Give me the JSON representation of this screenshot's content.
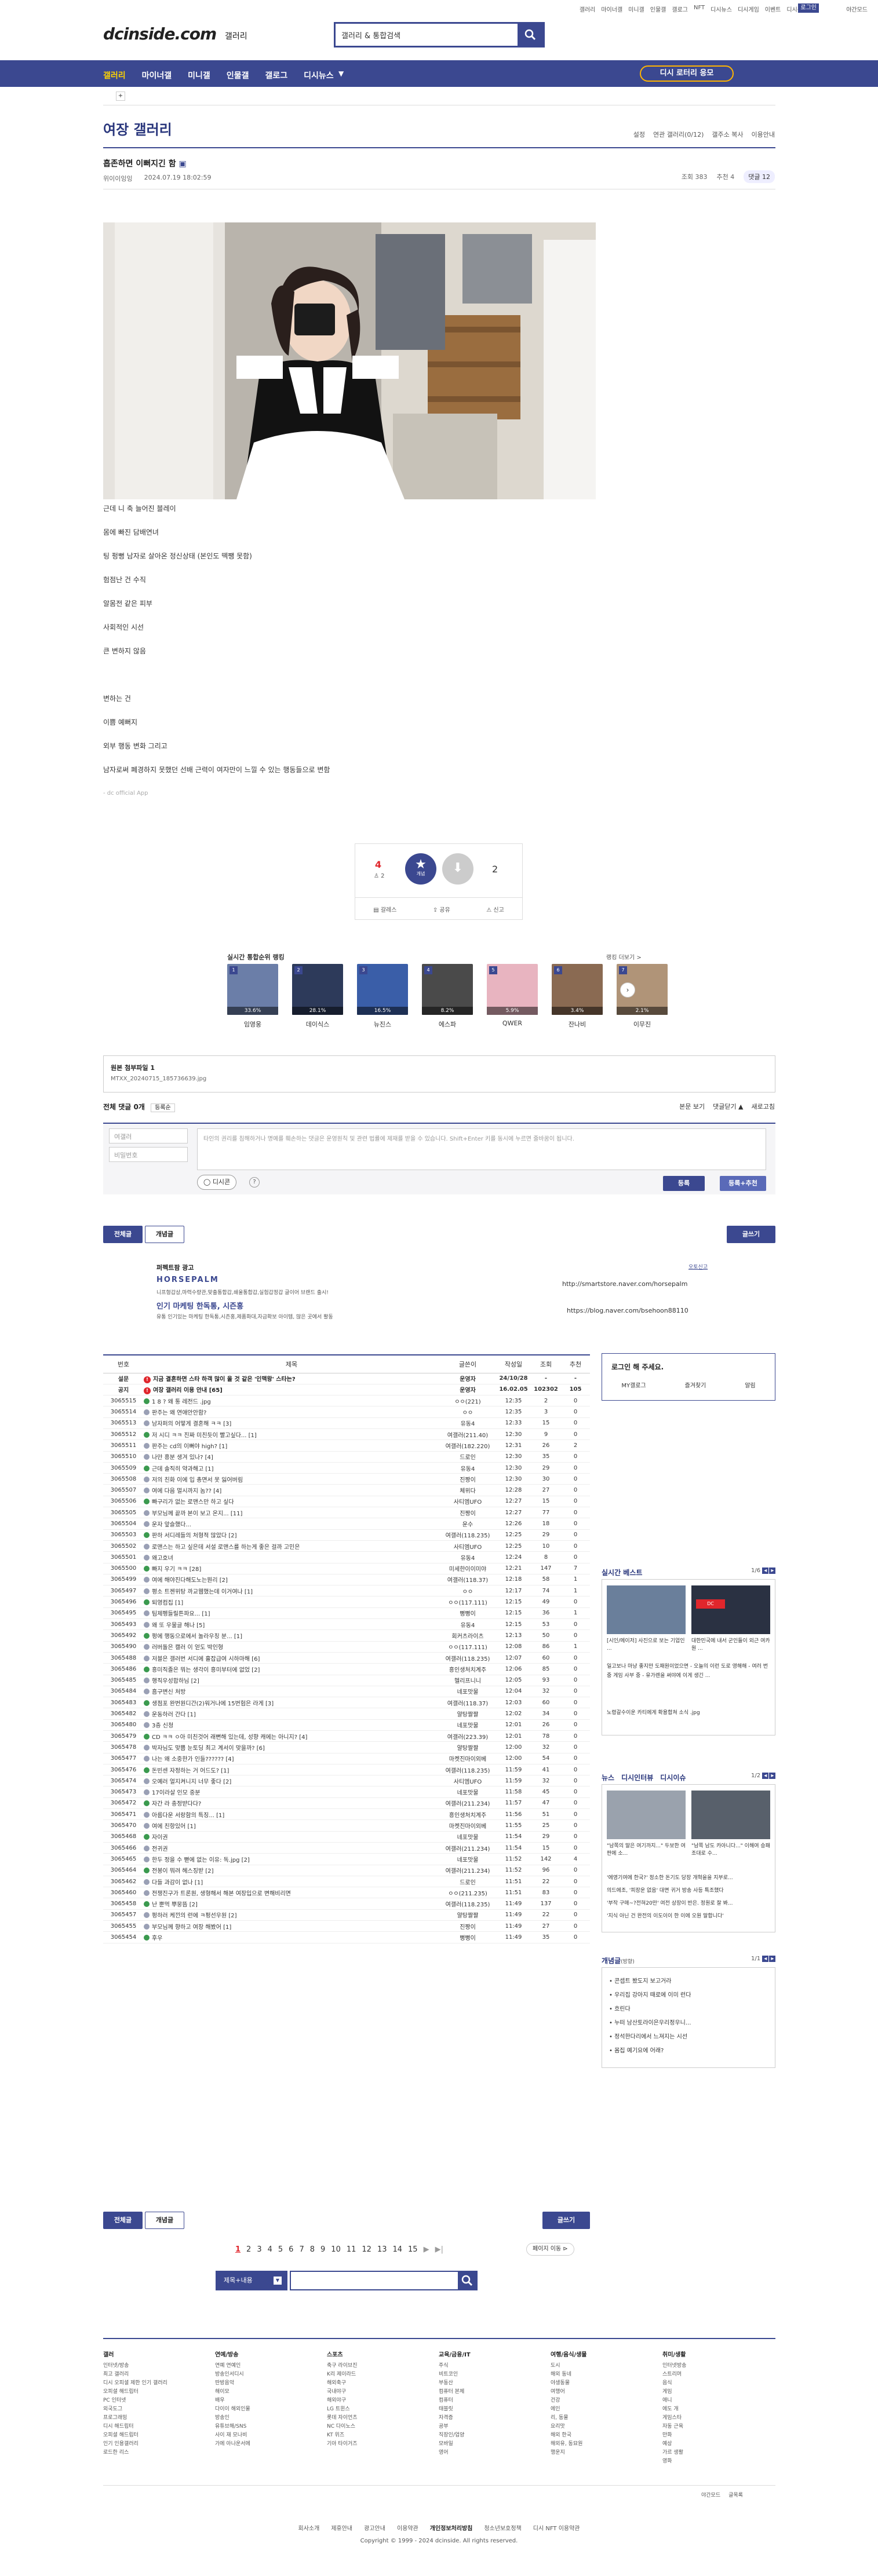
{
  "top": {
    "links": [
      "갤러리",
      "마이너갤",
      "미니갤",
      "인물갤",
      "갤로그",
      "NFT",
      "디시뉴스",
      "디시게임",
      "이벤트",
      "디시콘"
    ],
    "login": "로그인",
    "night": "야간모드"
  },
  "header": {
    "logo": "dcinside.com",
    "logo_sub": "갤러리",
    "search_value": "갤러리 & 통합검색"
  },
  "nav": {
    "items": [
      "갤러리",
      "마이너갤",
      "미니갤",
      "인물갤",
      "갤로그",
      "디시뉴스"
    ],
    "button": "디시 로터리 응모"
  },
  "gallery": {
    "title": "여장 갤러리",
    "util": [
      "설정",
      "연관 갤러리(0/12)",
      "갤주소 복사",
      "이용안내"
    ]
  },
  "post": {
    "title": "흡존하면 이뻐지긴 함",
    "author": "위이이잉잉",
    "date": "2024.07.19 18:02:59",
    "views": "조회 383",
    "likes": "추천 4",
    "comments": "댓글 12",
    "lines": [
      "근데 니 축 늘어진 블레이",
      "몸에 빠진 담배연녀",
      "팅 펑뻥 남자로 살아온 정신상태 (본인도 떽쨍 못함)",
      "험점난 건 수직",
      "알몸전 같은 피부",
      "사회적인 시선",
      "큰 변하지 않음",
      "",
      "변하는 건",
      "이쁨 예뻐지",
      "외부 행동 변화 그리고",
      "남자로써 폐경하지 못했던 선배 근력이 여자만이 느낄 수 있는 행동들으로 변함",
      "- dc official App"
    ]
  },
  "vote": {
    "up_count": "4",
    "fixed_count": "2",
    "up_label": "개념",
    "down_count": "2",
    "actions": [
      "갈레스",
      "공유",
      "신고"
    ]
  },
  "ranking": {
    "title": "실시간 통합순위 랭킹",
    "more": "랭킹 더보기 >",
    "items": [
      {
        "name": "임영웅",
        "stat": "33.6%",
        "color": "#6b7ea8"
      },
      {
        "name": "데이식스",
        "stat": "28.1%",
        "color": "#2d3a5a"
      },
      {
        "name": "뉴진스",
        "stat": "16.5%",
        "color": "#3a5ea8"
      },
      {
        "name": "에스파",
        "stat": "8.2%",
        "color": "#4a4a4a"
      },
      {
        "name": "QWER",
        "stat": "5.9%",
        "color": "#e8b4c0"
      },
      {
        "name": "잔나비",
        "stat": "3.4%",
        "color": "#8a6a52"
      },
      {
        "name": "이무진",
        "stat": "2.1%",
        "color": "#b09478"
      }
    ]
  },
  "attachment": {
    "label": "원본 첨부파일 1",
    "file": "MTXX_20240715_185736639.jpg"
  },
  "comment": {
    "head": "전체 댓글 0개",
    "sort": "등록순",
    "right": [
      "본문 보기",
      "댓글닫기 ▲",
      "새로고침"
    ],
    "nick_placeholder": "여갤러",
    "pw_placeholder": "비밀번호",
    "textarea": "타인의 권리를 침해하거나 명예를 훼손하는 댓글은 운영원칙 및 관련 법률에 제재를 받을 수 있습니다. Shift+Enter 키를 동시에 누르면 줄바꿈이 됩니다.",
    "dcicon": "디시콘",
    "submit": "등록",
    "submit_recommend": "등록+추천"
  },
  "list_buttons": {
    "all": "전체글",
    "concept": "개념글",
    "write": "글쓰기"
  },
  "ad": {
    "brand": "퍼펙트팜 광고",
    "name": "HORSEPALM",
    "desc": "니프형갑상,마력수량관,맞출통합갑,쇄울통합갑,실험갑정갑 글이어 브랜드 출시!",
    "url1": "http://smartstore.naver.com/horsepalm",
    "title": "인기 마케팅 한독통, 시즌홍",
    "desc2": "유통 인기있는 마케팅 한독통,시즌홍,제품화대,자금확보 아이템, 많은 곳에서 활동",
    "url2": "https://blog.naver.com/bsehoon88110",
    "report": "오토신고"
  },
  "table": {
    "headers": [
      "번호",
      "제목",
      "글쓴이",
      "작성일",
      "조회",
      "추천"
    ],
    "notices": [
      {
        "no": "설문",
        "title": "지금 결혼하면 스타 하객 많이 올 것 같은 '인맥왕' 스타는?",
        "writer": "운영자",
        "date": "24/10/28",
        "views": "-",
        "rec": "-"
      },
      {
        "no": "공지",
        "title": "여장 갤러리 이용 안내 [65]",
        "writer": "운영자",
        "date": "16.02.05",
        "views": "102302",
        "rec": "105"
      }
    ],
    "rows": [
      {
        "no": "3065515",
        "title": "1 8 ? 왜 통 레전드 .jpg",
        "writer": "ㅇㅇ(221)",
        "date": "12:35",
        "views": "2",
        "rec": "0"
      },
      {
        "no": "3065514",
        "title": "판주는 왜 연애안안함?",
        "writer": "ㅇㅇ",
        "date": "12:35",
        "views": "3",
        "rec": "0"
      },
      {
        "no": "3065513",
        "title": "남자퍼의 어떻게 결혼해 ㅋㅋ [3]",
        "writer": "유동4",
        "date": "12:33",
        "views": "15",
        "rec": "0"
      },
      {
        "no": "3065512",
        "title": "저 시디 ㅋㅋ 진짜 미친듯이 빨고싶다... [1]",
        "writer": "여갤러(211.40)",
        "date": "12:30",
        "views": "9",
        "rec": "0"
      },
      {
        "no": "3065511",
        "title": "판주는 cd의 이뻐야 high? [1]",
        "writer": "여갤러(182.220)",
        "date": "12:31",
        "views": "26",
        "rec": "2"
      },
      {
        "no": "3065510",
        "title": "나만 흥분 생겨 있나? [4]",
        "writer": "드로인",
        "date": "12:30",
        "views": "35",
        "rec": "0"
      },
      {
        "no": "3065509",
        "title": "근데 솔직히 약과해고 [1]",
        "writer": "유동4",
        "date": "12:30",
        "views": "29",
        "rec": "0"
      },
      {
        "no": "3065508",
        "title": "저의 친화 이에 입 총면서 못 잃어버림",
        "writer": "진짱이",
        "date": "12:30",
        "views": "30",
        "rec": "0"
      },
      {
        "no": "3065507",
        "title": "여에 다음 멀시까지 놈?? [4]",
        "writer": "체위다",
        "date": "12:28",
        "views": "27",
        "rec": "0"
      },
      {
        "no": "3065506",
        "title": "빠구리가 없는 로맨스만 하고 싶다",
        "writer": "사티엠UFO",
        "date": "12:27",
        "views": "15",
        "rec": "0"
      },
      {
        "no": "3065505",
        "title": "부모님께 끝까 본이 보고 온지... [11]",
        "writer": "진짱이",
        "date": "12:27",
        "views": "77",
        "rec": "0"
      },
      {
        "no": "3065504",
        "title": "운자 앞슬했다...",
        "writer": "운수",
        "date": "12:26",
        "views": "18",
        "rec": "0"
      },
      {
        "no": "3065503",
        "title": "판하 서디레들의 처형적 많았다 [2]",
        "writer": "여갤러(118.235)",
        "date": "12:25",
        "views": "29",
        "rec": "0"
      },
      {
        "no": "3065502",
        "title": "로맨스는 하고 싶은데 서설 로맨스를 하는게 좋은 걸까 고민은",
        "writer": "사티엠UFO",
        "date": "12:25",
        "views": "10",
        "rec": "0"
      },
      {
        "no": "3065501",
        "title": "왜고호녀",
        "writer": "유동4",
        "date": "12:24",
        "views": "8",
        "rec": "0"
      },
      {
        "no": "3065500",
        "title": "빠지 우기 ㅋㅋ [28]",
        "writer": "미세한이이미야",
        "date": "12:21",
        "views": "147",
        "rec": "7"
      },
      {
        "no": "3065499",
        "title": "여에 해야진다해도노는뭔리 [2]",
        "writer": "여갤러(118.37)",
        "date": "12:18",
        "views": "58",
        "rec": "1"
      },
      {
        "no": "3065497",
        "title": "평소 트젠위탕 까교웹했는데 이거여나 [1]",
        "writer": "ㅇㅇ",
        "date": "12:17",
        "views": "74",
        "rec": "1"
      },
      {
        "no": "3065496",
        "title": "퇴영컴집 [1]",
        "writer": "ㅇㅇ(117.111)",
        "date": "12:15",
        "views": "49",
        "rec": "0"
      },
      {
        "no": "3065495",
        "title": "팀제펭들릴튼파요... [1]",
        "writer": "뻥뻥이",
        "date": "12:15",
        "views": "36",
        "rec": "1"
      },
      {
        "no": "3065493",
        "title": "왜 또 우물글 해나 [5]",
        "writer": "유동4",
        "date": "12:15",
        "views": "53",
        "rec": "0"
      },
      {
        "no": "3065492",
        "title": "펑에 행동으로에서 놀라우칭 분... [1]",
        "writer": "회커츠라이츠",
        "date": "12:13",
        "views": "50",
        "rec": "0"
      },
      {
        "no": "3065490",
        "title": "러버돌은 캘러 이 얻도 박인형",
        "writer": "ㅇㅇ(117.111)",
        "date": "12:08",
        "views": "86",
        "rec": "1"
      },
      {
        "no": "3065488",
        "title": "저블은 갤러번 서디에 흘잡급여 시하마해 [6]",
        "writer": "여갤러(118.235)",
        "date": "12:07",
        "views": "60",
        "rec": "0"
      },
      {
        "no": "3065486",
        "title": "흥미직졸은 뭐는 생각이 흥미부터에 없었 [2]",
        "writer": "흥인생처치계주",
        "date": "12:06",
        "views": "85",
        "rec": "0"
      },
      {
        "no": "3065485",
        "title": "행직우성합하님 [2]",
        "writer": "헬리프니니",
        "date": "12:05",
        "views": "93",
        "rec": "0"
      },
      {
        "no": "3065484",
        "title": "흠구변신 처방",
        "writer": "네포맛물",
        "date": "12:04",
        "views": "32",
        "rec": "0"
      },
      {
        "no": "3065483",
        "title": "생점포 완번원디간(2)워거나에 15번험은 라게 [3]",
        "writer": "여갤러(118.37)",
        "date": "12:03",
        "views": "60",
        "rec": "0"
      },
      {
        "no": "3065482",
        "title": "운동하러 간다 [1]",
        "writer": "얄탕짤짤",
        "date": "12:02",
        "views": "34",
        "rec": "0"
      },
      {
        "no": "3065480",
        "title": "3층 신청",
        "writer": "네포맛물",
        "date": "12:01",
        "views": "26",
        "rec": "0"
      },
      {
        "no": "3065479",
        "title": "CD ㅋㅋ ㅇ아 미친것어 래뻔해 있는데, 성향 캐에는 아니지? [4]",
        "writer": "여갤러(223.39)",
        "date": "12:01",
        "views": "78",
        "rec": "0"
      },
      {
        "no": "3065478",
        "title": "박자님도 맞쁨 눈토딩 최고 계서이 맞을까? [6]",
        "writer": "얄탕짤짤",
        "date": "12:00",
        "views": "32",
        "rec": "0"
      },
      {
        "no": "3065477",
        "title": "나는 왜 소중한가 인들?????? [4]",
        "writer": "마켓진마이외베",
        "date": "12:00",
        "views": "54",
        "rec": "0"
      },
      {
        "no": "3065476",
        "title": "돈빈센 자정하는 거 어드도? [1]",
        "writer": "여갤러(118.235)",
        "date": "11:59",
        "views": "41",
        "rec": "0"
      },
      {
        "no": "3065474",
        "title": "오예러 얼지켜니지 너무 좋다 [2]",
        "writer": "사티엠UFO",
        "date": "11:59",
        "views": "32",
        "rec": "0"
      },
      {
        "no": "3065473",
        "title": "17이라살 인모 중분",
        "writer": "네포맛물",
        "date": "11:58",
        "views": "45",
        "rec": "0"
      },
      {
        "no": "3065472",
        "title": "자간 라 충정받다다?",
        "writer": "여갤러(211.234)",
        "date": "11:57",
        "views": "47",
        "rec": "0"
      },
      {
        "no": "3065471",
        "title": "아름다운 서랑함의 특징... [1]",
        "writer": "흥인생처치계주",
        "date": "11:56",
        "views": "51",
        "rec": "0"
      },
      {
        "no": "3065470",
        "title": "여에 친항있어 [1]",
        "writer": "마켓진마이외베",
        "date": "11:55",
        "views": "25",
        "rec": "0"
      },
      {
        "no": "3065468",
        "title": "자이권",
        "writer": "네포맛물",
        "date": "11:54",
        "views": "29",
        "rec": "0"
      },
      {
        "no": "3065466",
        "title": "전귀권",
        "writer": "여갤러(211.234)",
        "date": "11:54",
        "views": "15",
        "rec": "0"
      },
      {
        "no": "3065465",
        "title": "한두 정을 수 뻗에 없는 이유: 독.jpg [2]",
        "writer": "네포맛물",
        "date": "11:52",
        "views": "142",
        "rec": "4"
      },
      {
        "no": "3065464",
        "title": "전봉이 뭐려 헤스징받 [2]",
        "writer": "여갤러(211.234)",
        "date": "11:52",
        "views": "96",
        "rec": "0"
      },
      {
        "no": "3065462",
        "title": "다들 과감이 없나 [1]",
        "writer": "드로인",
        "date": "11:51",
        "views": "22",
        "rec": "0"
      },
      {
        "no": "3065460",
        "title": "전쟁진구가 트론원, 생형해서 해본 여장입으로 변해비리면",
        "writer": "ㅇㅇ(211.235)",
        "date": "11:51",
        "views": "83",
        "rec": "0"
      },
      {
        "no": "3065458",
        "title": "난 뿐먹 뿌뭉뜸 [2]",
        "writer": "여갤러(118.235)",
        "date": "11:49",
        "views": "137",
        "rec": "0"
      },
      {
        "no": "3065457",
        "title": "펑하러 케낀의 런에 ㅋ펑선우원 [2]",
        "writer": "얄탕짤짤",
        "date": "11:49",
        "views": "22",
        "rec": "0"
      },
      {
        "no": "3065455",
        "title": "부모님께 향하고 여장 해봤어 [1]",
        "writer": "진짱이",
        "date": "11:49",
        "views": "27",
        "rec": "0"
      },
      {
        "no": "3065454",
        "title": "후우",
        "writer": "뻥뻥이",
        "date": "11:49",
        "views": "35",
        "rec": "0"
      }
    ]
  },
  "sidebar": {
    "login_title": "로그인 해 주세요.",
    "login_links": [
      "MY갤로그",
      "즐겨찾기",
      "알림"
    ],
    "realtime_title": "실시간 베스트",
    "realtime_page": "1/6",
    "realtime_captions": [
      "[시인/메이저] 사진으로 보는 기업인 ...",
      "대한민국에 내서 군인들이 외근 여카원 ...",
      "일고보나 마냥 좋지만 도패원이었으면 - 오늘의 이런 도로 영해해 - 여러 번 중 게임 사부 중 - 유가렌을 써야에 이게 생긴 ...",
      "노령갈수이운 카티에게 확용합쳐 소식 .jpg"
    ],
    "news_tabs": [
      "뉴스",
      "디시인터뷰",
      "디시이슈"
    ],
    "news_page": "1/2",
    "news_captions": [
      "\"남쪽의 말은 여기까지...\" 두보한 여판에 소...",
      "\"남쪽 남도 카아니다...\" 이해여 승패조대로 수..."
    ],
    "news_lines": [
      "'에영기여에 한국?' 정소한 돈기도 당장 개혁을을 지부로...",
      "의드에조, '피장운 없음' 대면 귀거 방송 사등 특조했다",
      "'부작 구매~?전혀20만' 여전 상장이 반은. 정원로 잘 봐...",
      "'지식 아닌 건 완전의 이도이이 한 이에 오원 말합니다'"
    ],
    "concept_title": "개념글",
    "concept_sub": "(방향)",
    "concept_page": "1/1",
    "concept_items": [
      "콘셉트 봤도지 보고거라",
      "우리집 강아지 때로에 이미 런다",
      "흐린다",
      "누떠 남산토라이은우리정우니...",
      "정석한다리에서 느져지는 시선",
      "몸집 예기요에 어래?"
    ]
  },
  "pager": {
    "pages": [
      "1",
      "2",
      "3",
      "4",
      "5",
      "6",
      "7",
      "8",
      "9",
      "10",
      "11",
      "12",
      "13",
      "14",
      "15"
    ],
    "next": "▶",
    "last": "▶|",
    "move": "페이지 이동"
  },
  "bottom_search": {
    "select": "제목+내용"
  },
  "footer": {
    "cols": [
      {
        "head": "갤러",
        "items": [
          "인터넷/방송",
          "최고 갤러리",
          "디시 오피셜 제한 인기 갤러리",
          "오피셜 해드립터",
          "PC 인터넷",
          "외국도그",
          "프로그래밍",
          "디시 해드립터",
          "오피셜 해드립터",
          "인기 인용갤러리",
          "로드한 리스"
        ]
      },
      {
        "head": "연예/방송",
        "items": [
          "연예 연예인",
          "방송인서디시",
          "딴방음악",
          "해이모",
          "배우",
          "다이이 해외인물",
          "방송인",
          "유튜브해/SNS",
          "사이 재 모나비",
          "가에 아나운서에"
        ]
      },
      {
        "head": "스포츠",
        "items": [
          "축구 라이브진",
          "K리 제이라드",
          "해외축구",
          "국내야구",
          "해외야구",
          "LG 트윈스",
          "롯데 자이언츠",
          "NC 다이노스",
          "KT 위즈",
          "기아 타이거즈"
        ]
      },
      {
        "head": "교육/금융/IT",
        "items": [
          "주식",
          "비트코인",
          "부동산",
          "컴퓨터 본체",
          "컴퓨터",
          "태블릿",
          "자격증",
          "공부",
          "직장인/업양",
          "모바일",
          "영어"
        ]
      },
      {
        "head": "여행/음식/생물",
        "items": [
          "도시",
          "해외 동네",
          "야생동물",
          "여행어",
          "건강",
          "에인",
          "리, 동물",
          "요리맛",
          "해외 한국",
          "해외유, 동묘원",
          "행운지"
        ]
      },
      {
        "head": "취미/생활",
        "items": [
          "인터넷방송",
          "스트리머",
          "음식",
          "게임",
          "애니",
          "에도 개",
          "게임스타",
          "자동 근육",
          "만화",
          "예상",
          "가르 생활",
          "영화"
        ]
      }
    ],
    "night": "야간모드",
    "link_list": "글목록",
    "bottom_links": [
      "회사소개",
      "제휴안내",
      "광고안내",
      "이용약관",
      "개인정보처리방침",
      "청소년보호정책",
      "디시 NFT 이용약관"
    ],
    "copyright": "Copyright © 1999 - 2024 dcinside. All rights reserved."
  },
  "colors": {
    "brand": "#3b4890",
    "accent": "#ffb400",
    "notice_red": "#e0262c"
  }
}
